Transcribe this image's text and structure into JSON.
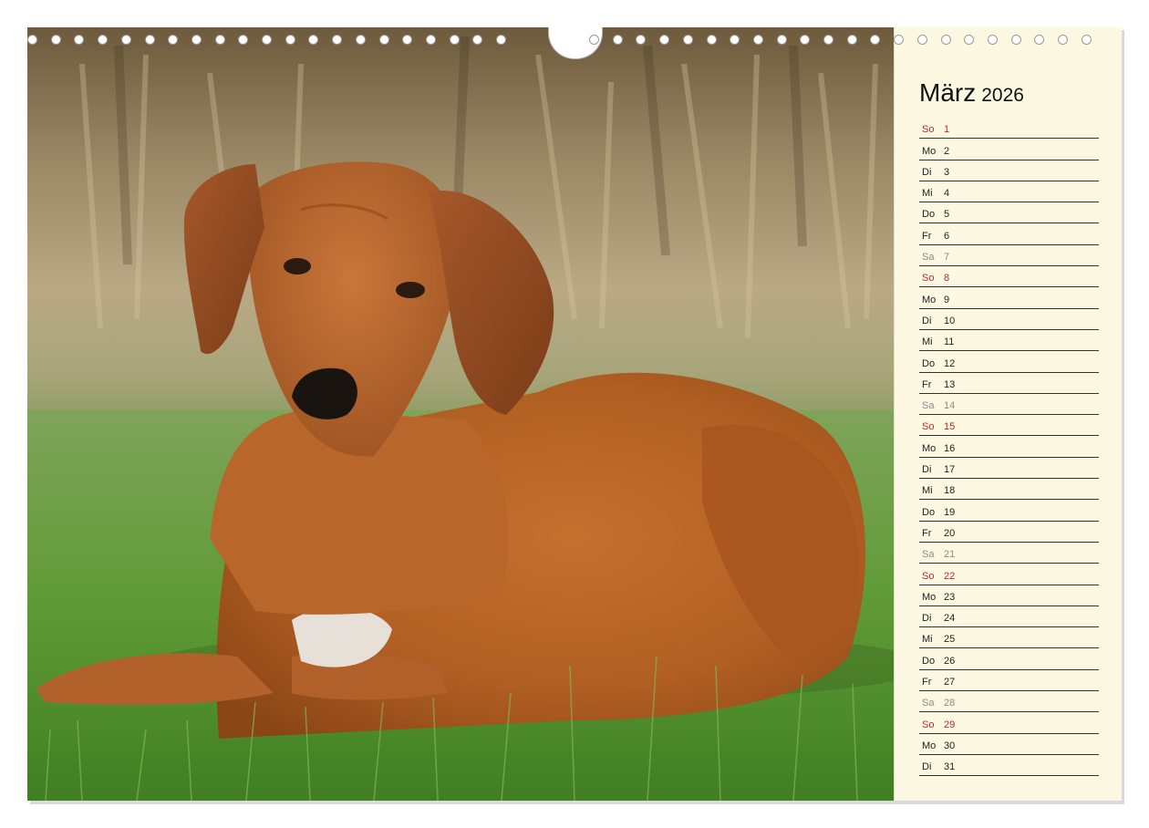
{
  "calendar": {
    "month": "März",
    "year": "2026",
    "days": [
      {
        "wd": "So",
        "d": "1",
        "type": "sun"
      },
      {
        "wd": "Mo",
        "d": "2",
        "type": "week"
      },
      {
        "wd": "Di",
        "d": "3",
        "type": "week"
      },
      {
        "wd": "Mi",
        "d": "4",
        "type": "week"
      },
      {
        "wd": "Do",
        "d": "5",
        "type": "week"
      },
      {
        "wd": "Fr",
        "d": "6",
        "type": "week"
      },
      {
        "wd": "Sa",
        "d": "7",
        "type": "sat"
      },
      {
        "wd": "So",
        "d": "8",
        "type": "sun"
      },
      {
        "wd": "Mo",
        "d": "9",
        "type": "week"
      },
      {
        "wd": "Di",
        "d": "10",
        "type": "week"
      },
      {
        "wd": "Mi",
        "d": "11",
        "type": "week"
      },
      {
        "wd": "Do",
        "d": "12",
        "type": "week"
      },
      {
        "wd": "Fr",
        "d": "13",
        "type": "week"
      },
      {
        "wd": "Sa",
        "d": "14",
        "type": "sat"
      },
      {
        "wd": "So",
        "d": "15",
        "type": "sun"
      },
      {
        "wd": "Mo",
        "d": "16",
        "type": "week"
      },
      {
        "wd": "Di",
        "d": "17",
        "type": "week"
      },
      {
        "wd": "Mi",
        "d": "18",
        "type": "week"
      },
      {
        "wd": "Do",
        "d": "19",
        "type": "week"
      },
      {
        "wd": "Fr",
        "d": "20",
        "type": "week"
      },
      {
        "wd": "Sa",
        "d": "21",
        "type": "sat"
      },
      {
        "wd": "So",
        "d": "22",
        "type": "sun"
      },
      {
        "wd": "Mo",
        "d": "23",
        "type": "week"
      },
      {
        "wd": "Di",
        "d": "24",
        "type": "week"
      },
      {
        "wd": "Mi",
        "d": "25",
        "type": "week"
      },
      {
        "wd": "Do",
        "d": "26",
        "type": "week"
      },
      {
        "wd": "Fr",
        "d": "27",
        "type": "week"
      },
      {
        "wd": "Sa",
        "d": "28",
        "type": "sat"
      },
      {
        "wd": "So",
        "d": "29",
        "type": "sun"
      },
      {
        "wd": "Mo",
        "d": "30",
        "type": "week"
      },
      {
        "wd": "Di",
        "d": "31",
        "type": "week"
      }
    ]
  },
  "colors": {
    "sunday": "#c0262d",
    "saturday": "#8a8a8a",
    "weekday": "#222222",
    "panel_background": "#fdf8e1"
  },
  "photo": {
    "subject": "rhodesian-ridgeback-dog-lying-on-grass"
  }
}
